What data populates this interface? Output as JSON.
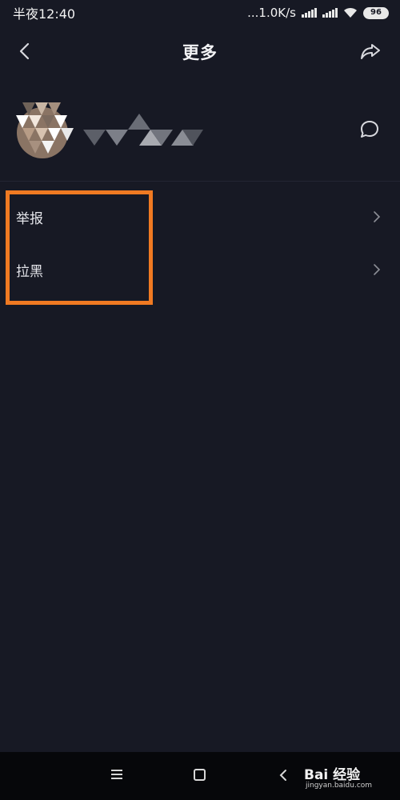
{
  "status_bar": {
    "time": "半夜12:40",
    "network_speed": "...1.0K/s",
    "battery": "96"
  },
  "nav": {
    "title": "更多",
    "icons": {
      "back": "chevron-left-icon",
      "share": "share-arrow-icon"
    }
  },
  "profile": {
    "icons": {
      "avatar": "avatar-mosaic",
      "chat": "chat-bubble-icon"
    }
  },
  "menu": {
    "items": [
      {
        "label": "举报"
      },
      {
        "label": "拉黑"
      }
    ]
  },
  "system_bar": {
    "watermark_main": "Bai 经验",
    "watermark_sub": "jingyan.baidu.com"
  },
  "colors": {
    "background": "#171924",
    "highlight": "#f07a22",
    "text": "#e6e7ec",
    "system_bar": "#06070a"
  }
}
